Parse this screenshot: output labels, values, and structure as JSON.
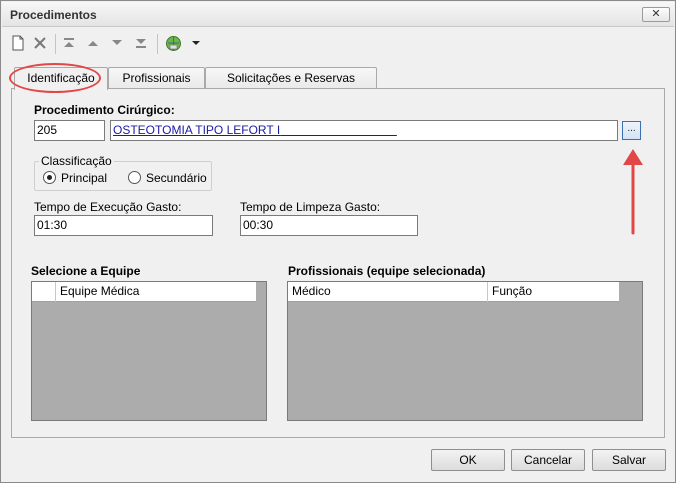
{
  "window": {
    "title": "Procedimentos",
    "close_label": "✕"
  },
  "toolbar": {
    "icons": [
      "new-document-icon",
      "delete-icon",
      "move-first-icon",
      "move-up-icon",
      "move-down-icon",
      "move-last-icon",
      "print-globe-icon",
      "dropdown-arrow-icon"
    ]
  },
  "tabs": [
    {
      "label": "Identificação",
      "active": true
    },
    {
      "label": "Profissionais",
      "active": false
    },
    {
      "label": "Solicitações e Reservas",
      "active": false
    }
  ],
  "procedimento": {
    "label": "Procedimento Cirúrgico:",
    "code": "205",
    "name": "OSTEOTOMIA TIPO LEFORT I",
    "lookup_label": "..."
  },
  "classificacao": {
    "title": "Classificação",
    "options": [
      {
        "label": "Principal",
        "checked": true
      },
      {
        "label": "Secundário",
        "checked": false
      }
    ]
  },
  "tempo_execucao": {
    "label": "Tempo de Execução Gasto:",
    "value": "01:30"
  },
  "tempo_limpeza": {
    "label": "Tempo de Limpeza Gasto:",
    "value": "00:30"
  },
  "equipe": {
    "title": "Selecione a Equipe",
    "columns": [
      "",
      "Equipe Médica"
    ]
  },
  "profissionais": {
    "title": "Profissionais (equipe selecionada)",
    "columns": [
      "Médico",
      "Função"
    ]
  },
  "buttons": {
    "ok": "OK",
    "cancel": "Cancelar",
    "save": "Salvar"
  },
  "colors": {
    "annotation": "#e14747",
    "link": "#1a1aa6",
    "grid_bg": "#acacac"
  }
}
